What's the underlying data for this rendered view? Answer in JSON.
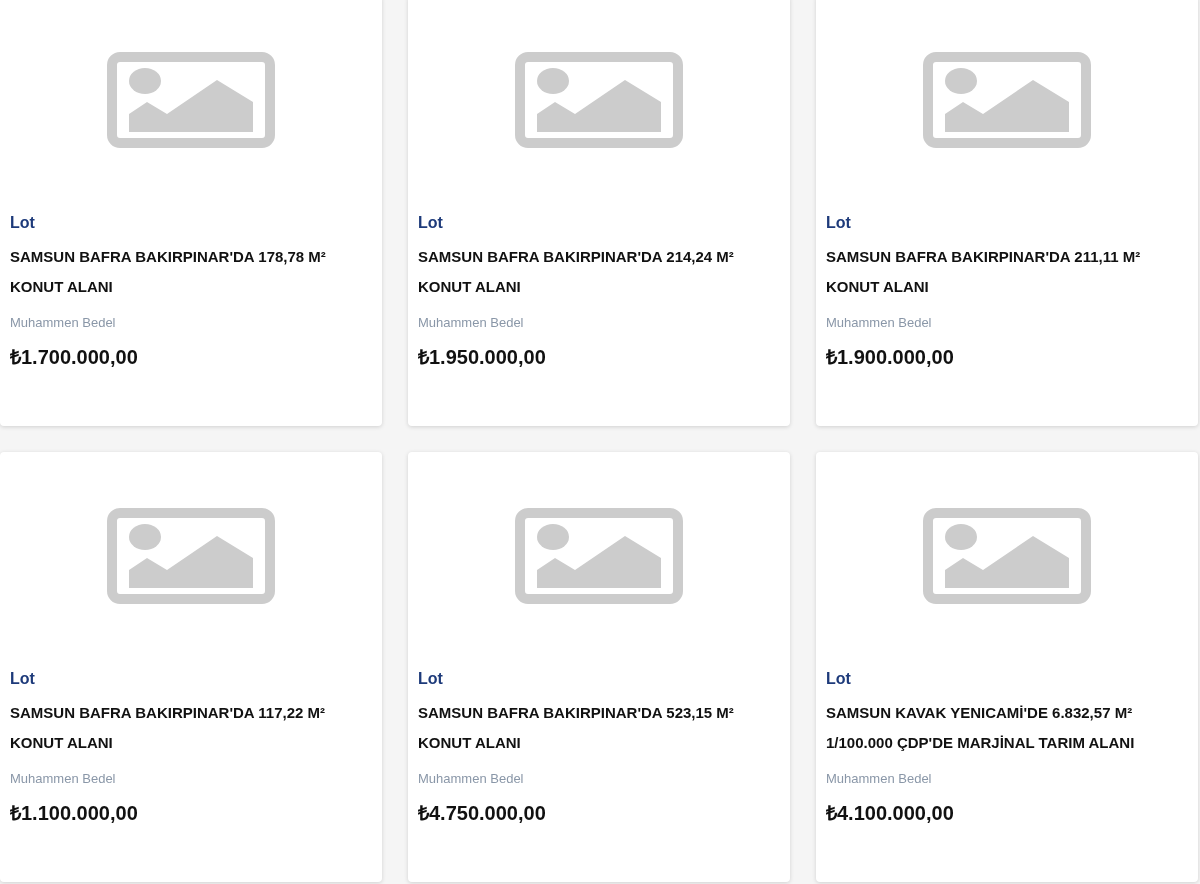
{
  "listings": [
    {
      "category": "Lot",
      "title_lines": [
        "SAMSUN BAFRA BAKIRPINAR'DA 178,78 M²",
        "KONUT ALANI"
      ],
      "price_label": "Muhammen Bedel",
      "price": "₺1.700.000,00"
    },
    {
      "category": "Lot",
      "title_lines": [
        "SAMSUN BAFRA BAKIRPINAR'DA 214,24 M²",
        "KONUT ALANI"
      ],
      "price_label": "Muhammen Bedel",
      "price": "₺1.950.000,00"
    },
    {
      "category": "Lot",
      "title_lines": [
        "SAMSUN BAFRA BAKIRPINAR'DA 211,11 M²",
        "KONUT ALANI"
      ],
      "price_label": "Muhammen Bedel",
      "price": "₺1.900.000,00"
    },
    {
      "category": "Lot",
      "title_lines": [
        "SAMSUN BAFRA BAKIRPINAR'DA 117,22 M²",
        "KONUT ALANI"
      ],
      "price_label": "Muhammen Bedel",
      "price": "₺1.100.000,00"
    },
    {
      "category": "Lot",
      "title_lines": [
        "SAMSUN BAFRA BAKIRPINAR'DA 523,15 M²",
        "KONUT ALANI"
      ],
      "price_label": "Muhammen Bedel",
      "price": "₺4.750.000,00"
    },
    {
      "category": "Lot",
      "title_lines": [
        "SAMSUN KAVAK YENICAMİ'DE 6.832,57 M²",
        "1/100.000 ÇDP'DE MARJİNAL TARIM ALANI"
      ],
      "price_label": "Muhammen Bedel",
      "price": "₺4.100.000,00"
    }
  ]
}
